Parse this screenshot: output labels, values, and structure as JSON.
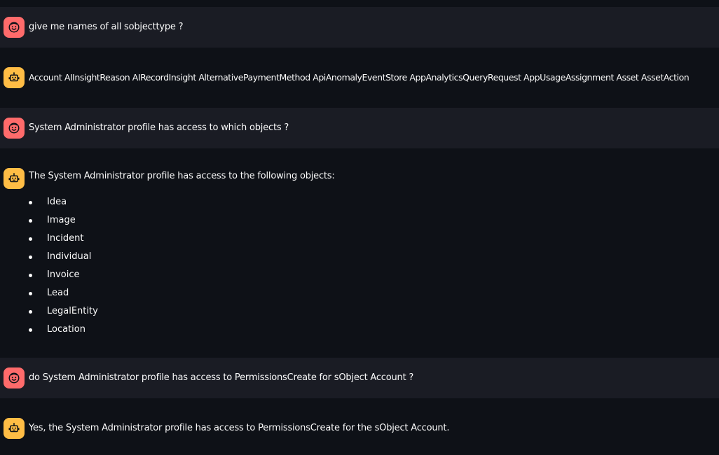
{
  "conversation": {
    "messages": [
      {
        "role": "user",
        "avatar_icon": "smiling-face-icon",
        "text": "give me names of all sobjecttype ?"
      },
      {
        "role": "assistant",
        "avatar_icon": "robot-icon",
        "text": "Account AIInsightReason AIRecordInsight AlternativePaymentMethod ApiAnomalyEventStore AppAnalyticsQueryRequest AppUsageAssignment Asset AssetAction"
      },
      {
        "role": "user",
        "avatar_icon": "smiling-face-icon",
        "text": "System Administrator profile has access to which objects ?"
      },
      {
        "role": "assistant",
        "avatar_icon": "robot-icon",
        "text": "The System Administrator profile has access to the following objects:",
        "list": [
          "Idea",
          "Image",
          "Incident",
          "Individual",
          "Invoice",
          "Lead",
          "LegalEntity",
          "Location"
        ]
      },
      {
        "role": "user",
        "avatar_icon": "smiling-face-icon",
        "text": "do System Administrator profile has access to PermissionsCreate for sObject Account ?"
      },
      {
        "role": "assistant",
        "avatar_icon": "robot-icon",
        "text": "Yes, the System Administrator profile has access to PermissionsCreate for the sObject Account."
      }
    ]
  },
  "colors": {
    "background": "#0e1117",
    "user_message_background": "#1a1c24",
    "user_avatar": "#ff6b6b",
    "assistant_avatar": "#ffbd45",
    "text": "#fafafa"
  }
}
